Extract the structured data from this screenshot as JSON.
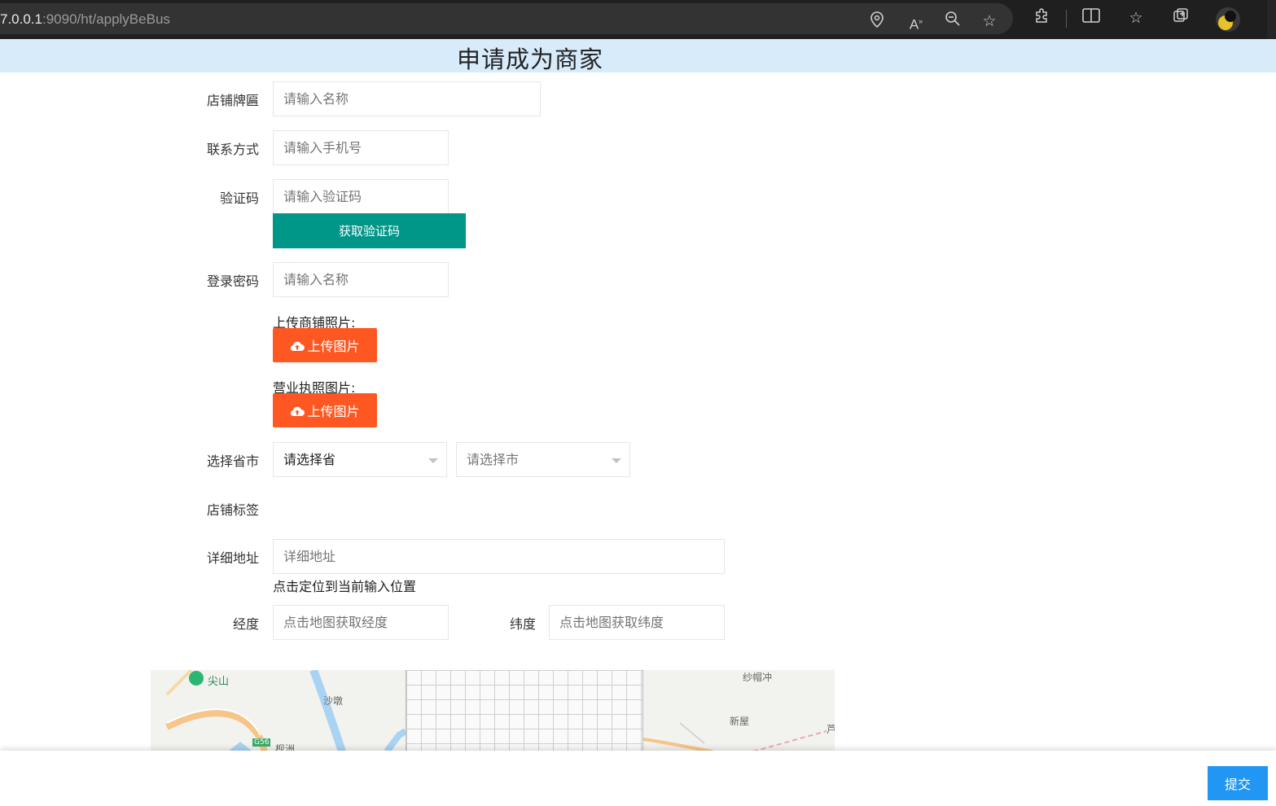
{
  "browser": {
    "url_host": "7.0.0.1",
    "url_rest": ":9090/ht/applyBeBus",
    "icons": [
      "location-icon",
      "read-aloud-icon",
      "zoom-out-icon",
      "add-favorite-icon",
      "extensions-icon",
      "split-screen-icon",
      "favorites-icon",
      "collections-icon",
      "profile-avatar"
    ]
  },
  "page": {
    "title": "申请成为商家"
  },
  "form": {
    "shop_name": {
      "label": "店铺牌匾",
      "placeholder": "请输入名称"
    },
    "phone": {
      "label": "联系方式",
      "placeholder": "请输入手机号"
    },
    "code": {
      "label": "验证码",
      "placeholder": "请输入验证码",
      "button": "获取验证码"
    },
    "password": {
      "label": "登录密码",
      "placeholder": "请输入名称"
    },
    "shop_photo": {
      "label": "上传商铺照片:",
      "button": "上传图片"
    },
    "license_photo": {
      "label": "营业执照图片:",
      "button": "上传图片"
    },
    "region": {
      "label": "选择省市",
      "province": "请选择省",
      "city": "请选择市"
    },
    "tags": {
      "label": "店铺标签"
    },
    "address": {
      "label": "详细地址",
      "placeholder": "详细地址",
      "hint": "点击定位到当前输入位置"
    },
    "longitude": {
      "label": "经度",
      "placeholder": "点击地图获取经度"
    },
    "latitude": {
      "label": "纬度",
      "placeholder": "点击地图获取纬度"
    }
  },
  "map": {
    "labels": [
      "尖山",
      "沙墩",
      "G56",
      "枧洲",
      "纱帽冲",
      "新屋",
      "芦"
    ]
  },
  "footer": {
    "submit": "提交"
  },
  "colors": {
    "header_bg": "#d7ebfb",
    "green": "#009688",
    "orange": "#ff5722",
    "blue": "#2196f3"
  }
}
